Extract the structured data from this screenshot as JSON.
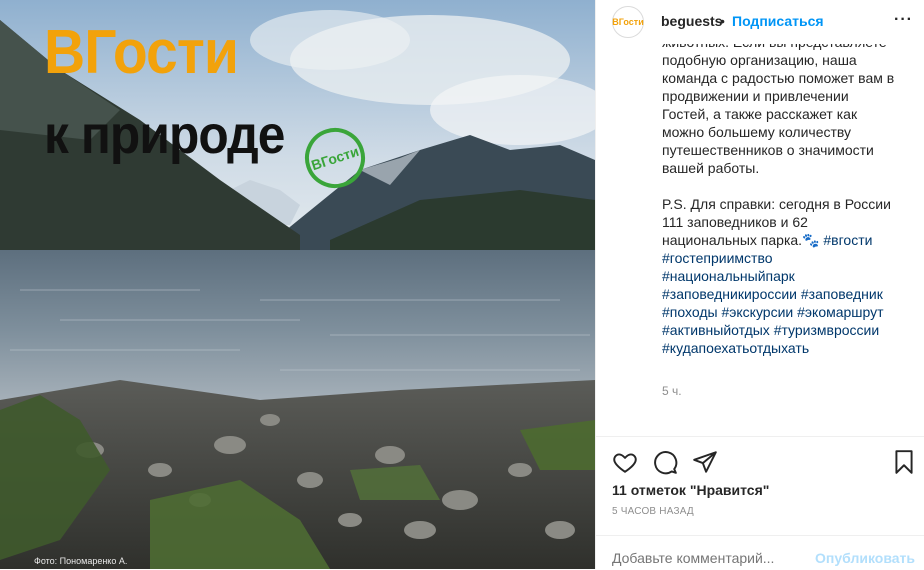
{
  "photo": {
    "title_line1": "ВГости",
    "title_line2": "к природе",
    "stamp_text": "ВГости",
    "credit": "Фото: Пономаренко А."
  },
  "header": {
    "avatar_text": "ВГости",
    "username": "beguests",
    "separator": "•",
    "follow_label": "Подписаться",
    "more_label": "···"
  },
  "caption": {
    "lines1": [
      "животных. Если вы представляете",
      "подобную организацию, наша",
      "команда с радостью поможет вам в",
      "продвижении и привлечении",
      "Гостей, а также расскажет как",
      "можно большему количеству",
      "путешественников о значимости",
      "вашей работы."
    ],
    "ps_lines": [
      "P.S. Для справки: сегодня в России",
      "111 заповедников и 62",
      "национальных парка.🐾"
    ],
    "tags": {
      "t1": "#вгости",
      "t2": "#гостеприимство",
      "t3": "#национальныйпарк",
      "t4": "#заповедникироссии",
      "t5": "#заповедник",
      "t6": "#походы",
      "t7": "#экскурсии",
      "t8": "#экомаршрут",
      "t9": "#активныйотдых",
      "t10": "#туризмвроссии",
      "t11": "#кудапоехатьотдыхать"
    },
    "time_ago": "5 ч."
  },
  "actions": {
    "icons": [
      "heart-icon",
      "comment-icon",
      "share-icon",
      "bookmark-icon"
    ]
  },
  "likes": "11 отметок \"Нравится\"",
  "date": "5 ЧАСОВ НАЗАД",
  "comment": {
    "placeholder": "Добавьте комментарий...",
    "publish_label": "Опубликовать"
  },
  "colors": {
    "link": "#0095f6",
    "hashtag": "#00376b",
    "brand_orange": "#f2a20b",
    "stamp_green": "#3aa53a"
  }
}
